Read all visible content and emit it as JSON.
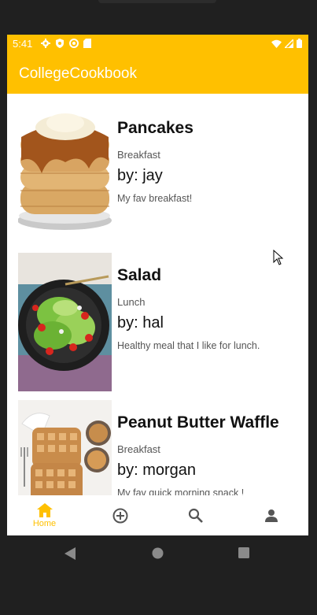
{
  "status_bar": {
    "time": "5:41",
    "color": "#ffc000"
  },
  "app_bar": {
    "title": "CollegeCookbook"
  },
  "recipes": [
    {
      "name": "Pancakes",
      "category": "Breakfast",
      "author": "by: jay",
      "description": "My fav breakfast!",
      "image": "pancakes-photo"
    },
    {
      "name": "Salad",
      "category": "Lunch",
      "author": "by: hal",
      "description": "Healthy meal that I like for lunch.",
      "image": "salad-photo"
    },
    {
      "name": "Peanut Butter Waffle",
      "category": "Breakfast",
      "author": "by: morgan",
      "description": "My fav quick morning snack !",
      "image": "waffle-photo"
    }
  ],
  "bottom_nav": {
    "items": [
      {
        "label": "Home",
        "icon": "home-icon",
        "active": true
      },
      {
        "label": "",
        "icon": "add-circle-icon",
        "active": false
      },
      {
        "label": "",
        "icon": "search-icon",
        "active": false
      },
      {
        "label": "",
        "icon": "person-icon",
        "active": false
      }
    ],
    "active_color": "#ffc000",
    "inactive_color": "#555555"
  }
}
